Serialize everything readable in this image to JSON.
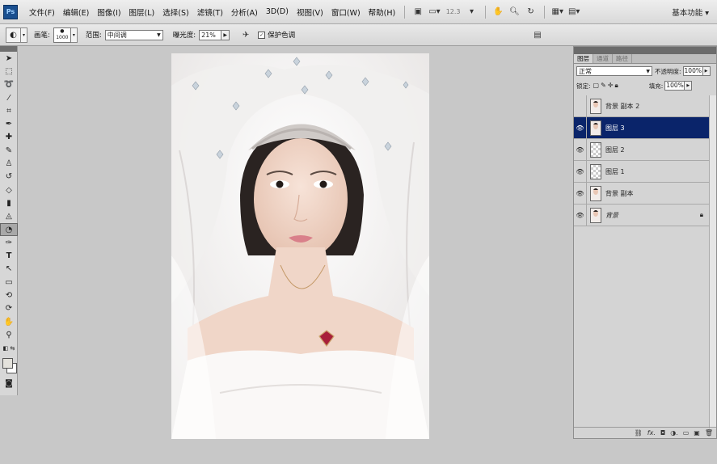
{
  "app": {
    "logo": "Ps"
  },
  "menu": [
    "文件(F)",
    "编辑(E)",
    "图像(I)",
    "图层(L)",
    "选择(S)",
    "滤镜(T)",
    "分析(A)",
    "3D(D)",
    "视图(V)",
    "窗口(W)",
    "帮助(H)"
  ],
  "menubar_right": {
    "zoom": "12.3",
    "workspace": "基本功能"
  },
  "options": {
    "brush_label": "画笔:",
    "brush_size": "1000",
    "range_label": "范围:",
    "range_value": "中间调",
    "exposure_label": "曝光度:",
    "exposure_value": "21%",
    "protect_label": "保护色调",
    "protect_checked": true
  },
  "panel": {
    "tabs": [
      "图层",
      "通道",
      "路径"
    ],
    "blend_mode": "正常",
    "opacity_label": "不透明度:",
    "opacity_value": "100%",
    "lock_label": "锁定:",
    "fill_label": "填充:",
    "fill_value": "100%",
    "bottom_icons": [
      "link-icon",
      "fx-icon",
      "mask-icon",
      "adjustment-icon",
      "folder-icon",
      "new-layer-icon",
      "trash-icon"
    ]
  },
  "layers": [
    {
      "name": "背景 副本 2",
      "visible": false,
      "selected": false,
      "thumb": "photo"
    },
    {
      "name": "图层 3",
      "visible": true,
      "selected": true,
      "thumb": "photo"
    },
    {
      "name": "图层 2",
      "visible": true,
      "selected": false,
      "thumb": "transparent"
    },
    {
      "name": "图层 1",
      "visible": true,
      "selected": false,
      "thumb": "transparent"
    },
    {
      "name": "背景 副本",
      "visible": true,
      "selected": false,
      "thumb": "photo"
    },
    {
      "name": "背景",
      "visible": true,
      "selected": false,
      "thumb": "photo",
      "locked": true,
      "italic": true
    }
  ],
  "tools": [
    "move-tool",
    "marquee-tool",
    "lasso-tool",
    "quick-select-tool",
    "crop-tool",
    "eyedropper-tool",
    "healing-brush-tool",
    "brush-tool",
    "clone-stamp-tool",
    "history-brush-tool",
    "eraser-tool",
    "gradient-tool",
    "blur-tool",
    "dodge-tool",
    "pen-tool",
    "type-tool",
    "path-select-tool",
    "shape-tool",
    "3d-rotate-tool",
    "3d-orbit-tool",
    "hand-tool",
    "zoom-tool"
  ],
  "active_tool": "dodge-tool",
  "colors": {
    "foreground": "#e4e2dc",
    "background": "#ffffff",
    "selected_layer": "#0a246a"
  }
}
